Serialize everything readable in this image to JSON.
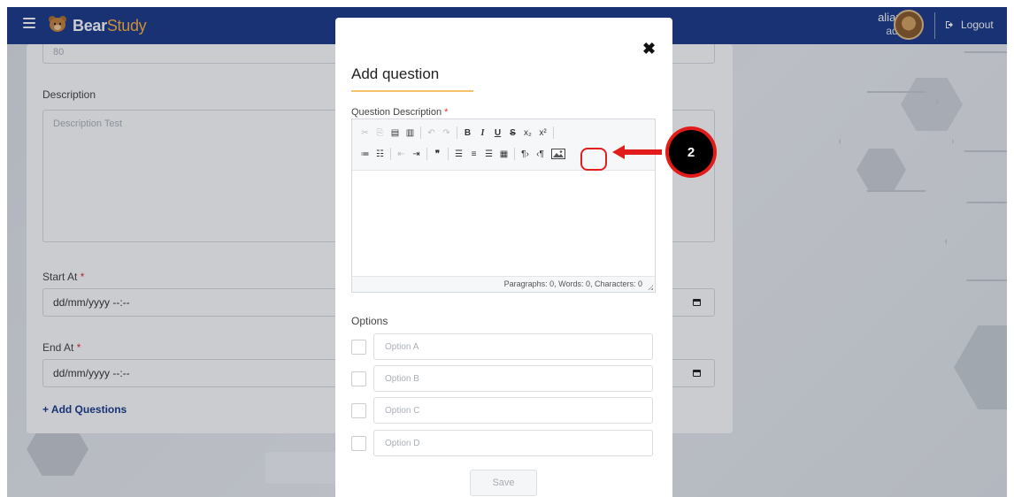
{
  "navbar": {
    "brand_main": "Bear",
    "brand_accent": "Study",
    "user_name": "aliando",
    "user_role": "admin",
    "logout_label": "Logout"
  },
  "background_form": {
    "top_field_value": "80",
    "description_label": "Description",
    "description_placeholder": "Description Test",
    "start_label": "Start At",
    "start_value": "dd/mm/yyyy --:--",
    "end_label": "End At",
    "end_value": "dd/mm/yyyy --:--",
    "required_mark": "*",
    "add_questions_label": "+ Add Questions"
  },
  "modal": {
    "close_symbol": "✖",
    "title": "Add question",
    "question_label": "Question Description",
    "required_mark": "*",
    "editor_status": "Paragraphs: 0, Words: 0, Characters: 0",
    "options_label": "Options",
    "options": [
      {
        "placeholder": "Option A"
      },
      {
        "placeholder": "Option B"
      },
      {
        "placeholder": "Option C"
      },
      {
        "placeholder": "Option D"
      }
    ],
    "save_label": "Save"
  },
  "toolbar": {
    "row1": [
      "cut-icon",
      "copy-icon",
      "paste-icon",
      "paste-text-icon",
      "undo-icon",
      "redo-icon",
      "bold-icon",
      "italic-icon",
      "underline-icon",
      "strikethrough-icon",
      "subscript-icon",
      "superscript-icon"
    ],
    "row2": [
      "numbered-list-icon",
      "bulleted-list-icon",
      "outdent-icon",
      "indent-icon",
      "blockquote-icon",
      "align-left-icon",
      "align-center-icon",
      "align-right-icon",
      "justify-icon",
      "ltr-icon",
      "rtl-icon",
      "image-icon"
    ],
    "glyphs": {
      "bold": "B",
      "italic": "I",
      "underline": "U",
      "strike": "S",
      "subscript": "x₂",
      "superscript": "x²",
      "quote": "❞"
    }
  },
  "annotation": {
    "step_number": "2"
  },
  "colors": {
    "navbar_bg": "#1c3a8a",
    "brand_accent": "#ffb13c",
    "title_underline": "#f5c26b",
    "annotation_red": "#e21b1b"
  }
}
